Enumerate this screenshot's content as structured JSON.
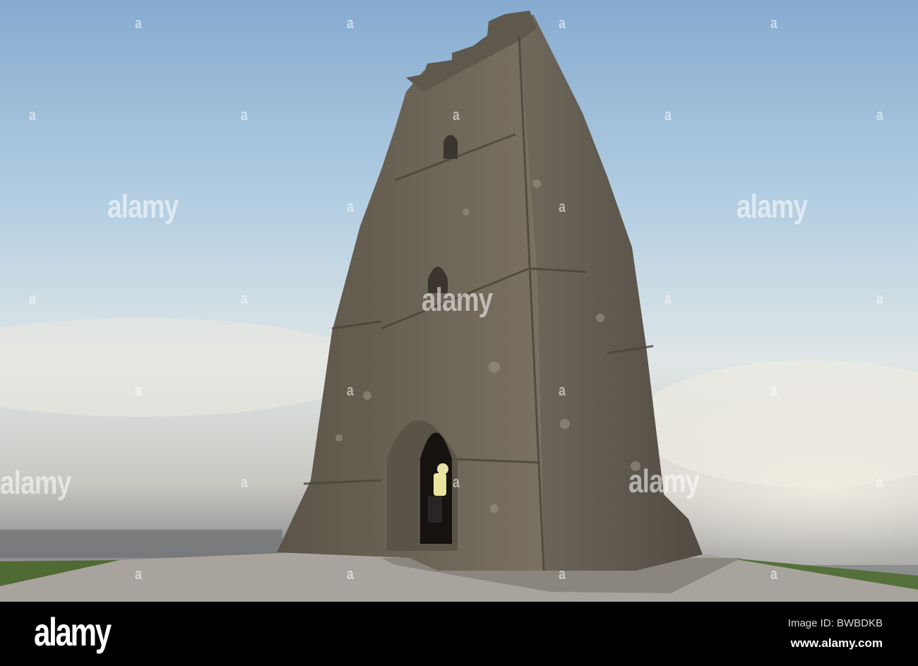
{
  "photo": {
    "subject": "stone-tower",
    "colors": {
      "sky_top": "#8fb3d6",
      "sky_mid": "#c9dce8",
      "horizon": "#e8e3d8",
      "stone": "#6e665a",
      "ground": "#a7a39c"
    }
  },
  "watermarks": {
    "letter": "a",
    "word": "alamy"
  },
  "footer": {
    "logo": "alamy",
    "image_id": "Image ID: BWBDKB",
    "url": "www.alamy.com"
  }
}
